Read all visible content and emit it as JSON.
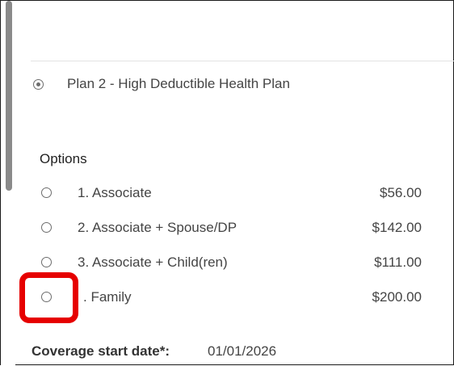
{
  "plan": {
    "label": "Plan 2 - High Deductible Health Plan",
    "selected": true
  },
  "options": {
    "heading": "Options",
    "items": [
      {
        "label": "1. Associate",
        "price": "$56.00",
        "selected": false
      },
      {
        "label": "2. Associate + Spouse/DP",
        "price": "$142.00",
        "selected": false
      },
      {
        "label": "3. Associate + Child(ren)",
        "price": "$111.00",
        "selected": false
      },
      {
        "label": ". Family",
        "price": "$200.00",
        "selected": false
      }
    ]
  },
  "coverage": {
    "label": "Coverage start date*:",
    "value": "01/01/2026"
  },
  "colors": {
    "highlight": "#e60000",
    "scrollbar": "#8a8a8a"
  }
}
